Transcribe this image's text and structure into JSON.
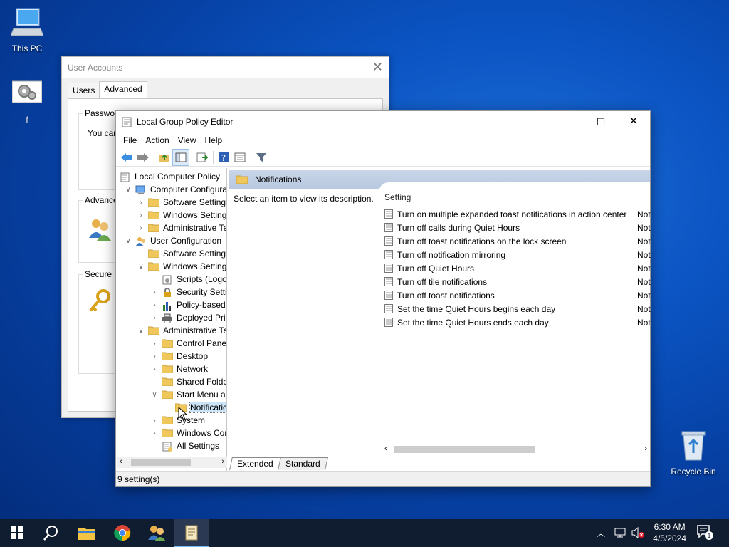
{
  "desktop": {
    "icons": [
      {
        "label": "This PC",
        "icon": "computer-icon"
      },
      {
        "label": "f",
        "icon": "gears-icon"
      },
      {
        "label": "Recycle Bin",
        "icon": "recycle-bin-icon"
      }
    ]
  },
  "user_accounts": {
    "title": "User Accounts",
    "tabs": [
      "Users",
      "Advanced"
    ],
    "groups": [
      {
        "label": "Passwor",
        "text": "You can"
      },
      {
        "label": "Advance"
      },
      {
        "label": "Secure s"
      }
    ]
  },
  "gpe": {
    "title": "Local Group Policy Editor",
    "menu": [
      "File",
      "Action",
      "View",
      "Help"
    ],
    "tree": [
      {
        "label": "Local Computer Policy",
        "level": 0,
        "chev": "",
        "icon": "policy-icon"
      },
      {
        "label": "Computer Configura",
        "level": 1,
        "chev": "∨",
        "icon": "computer-icon"
      },
      {
        "label": "Software Settings",
        "level": 2,
        "chev": "›",
        "icon": "folder-icon"
      },
      {
        "label": "Windows Setting",
        "level": 2,
        "chev": "›",
        "icon": "folder-icon"
      },
      {
        "label": "Administrative Te",
        "level": 2,
        "chev": "›",
        "icon": "folder-icon"
      },
      {
        "label": "User Configuration",
        "level": 1,
        "chev": "∨",
        "icon": "users-icon"
      },
      {
        "label": "Software Settings",
        "level": 2,
        "chev": "",
        "icon": "folder-icon"
      },
      {
        "label": "Windows Setting",
        "level": 2,
        "chev": "∨",
        "icon": "folder-icon"
      },
      {
        "label": "Scripts (Logo",
        "level": 3,
        "chev": "",
        "icon": "script-icon"
      },
      {
        "label": "Security Settin",
        "level": 3,
        "chev": "›",
        "icon": "security-icon"
      },
      {
        "label": "Policy-based",
        "level": 3,
        "chev": "›",
        "icon": "chart-icon"
      },
      {
        "label": "Deployed Prir",
        "level": 3,
        "chev": "›",
        "icon": "printer-icon"
      },
      {
        "label": "Administrative Te",
        "level": 2,
        "chev": "∨",
        "icon": "folder-icon"
      },
      {
        "label": "Control Panel",
        "level": 3,
        "chev": "›",
        "icon": "folder-icon"
      },
      {
        "label": "Desktop",
        "level": 3,
        "chev": "›",
        "icon": "folder-icon"
      },
      {
        "label": "Network",
        "level": 3,
        "chev": "›",
        "icon": "folder-icon"
      },
      {
        "label": "Shared Folder",
        "level": 3,
        "chev": "",
        "icon": "folder-icon"
      },
      {
        "label": "Start Menu ar",
        "level": 3,
        "chev": "∨",
        "icon": "folder-icon"
      },
      {
        "label": "Notificatic",
        "level": 4,
        "chev": "",
        "icon": "folder-icon",
        "selected": true
      },
      {
        "label": "System",
        "level": 3,
        "chev": "›",
        "icon": "folder-icon"
      },
      {
        "label": "Windows Cor",
        "level": 3,
        "chev": "›",
        "icon": "folder-icon"
      },
      {
        "label": "All Settings",
        "level": 3,
        "chev": "",
        "icon": "settings-list-icon"
      }
    ],
    "header": "Notifications",
    "description": "Select an item to view its description.",
    "column_setting": "Setting",
    "settings": [
      {
        "name": "Turn on multiple expanded toast notifications in action center",
        "state": "Not"
      },
      {
        "name": "Turn off calls during Quiet Hours",
        "state": "Not"
      },
      {
        "name": "Turn off toast notifications on the lock screen",
        "state": "Not"
      },
      {
        "name": "Turn off notification mirroring",
        "state": "Not"
      },
      {
        "name": "Turn off Quiet Hours",
        "state": "Not"
      },
      {
        "name": "Turn off tile notifications",
        "state": "Not"
      },
      {
        "name": "Turn off toast notifications",
        "state": "Not"
      },
      {
        "name": "Set the time Quiet Hours begins each day",
        "state": "Not"
      },
      {
        "name": "Set the time Quiet Hours ends each day",
        "state": "Not"
      }
    ],
    "tabs": [
      "Extended",
      "Standard"
    ],
    "status": "9 setting(s)"
  },
  "taskbar": {
    "time": "6:30 AM",
    "date": "4/5/2024",
    "notification_count": "1"
  }
}
